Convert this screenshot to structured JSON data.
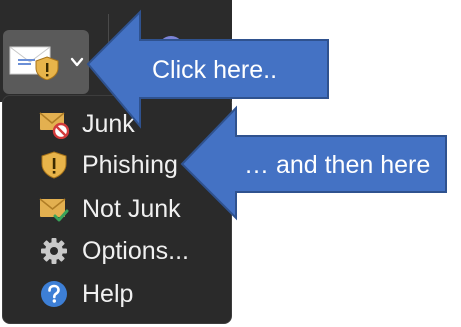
{
  "menu": {
    "items": [
      {
        "label": "Junk",
        "icon": "junk-envelope-icon"
      },
      {
        "label": "Phishing",
        "icon": "phishing-shield-icon"
      },
      {
        "label": "Not Junk",
        "icon": "not-junk-envelope-icon"
      },
      {
        "label": "Options...",
        "icon": "gear-icon"
      },
      {
        "label": "Help",
        "icon": "help-icon"
      }
    ]
  },
  "callouts": {
    "first": "Click here..",
    "second": "… and then here"
  },
  "colors": {
    "callout_fill": "#4472c4",
    "callout_border": "#2f528f",
    "toolbar_bg": "#2b2b2b",
    "menu_bg": "#2a2a2a",
    "button_pressed_bg": "#5a5a5a"
  }
}
